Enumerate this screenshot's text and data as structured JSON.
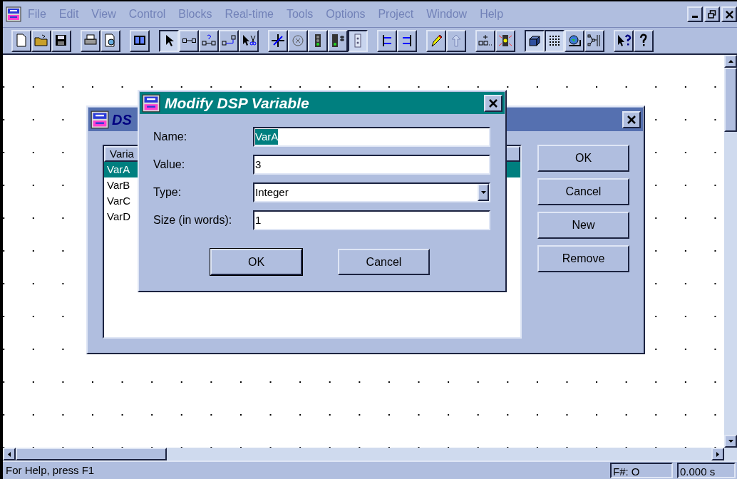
{
  "menu": [
    "File",
    "Edit",
    "View",
    "Control",
    "Blocks",
    "Real-time",
    "Tools",
    "Options",
    "Project",
    "Window",
    "Help"
  ],
  "toolbar": [
    [
      {
        "pressed": false
      },
      {
        "pressed": false
      },
      {
        "pressed": false
      }
    ],
    [
      {
        "pressed": false
      },
      {
        "pressed": false
      }
    ],
    [
      {
        "pressed": false
      }
    ],
    [
      {
        "pressed": true
      },
      {
        "pressed": false
      },
      {
        "pressed": false
      },
      {
        "pressed": false
      },
      {
        "pressed": false
      }
    ],
    [
      {
        "pressed": false
      },
      {
        "pressed": false
      },
      {
        "pressed": false
      },
      {
        "pressed": false
      },
      {
        "pressed": true
      }
    ],
    [
      {
        "pressed": false
      },
      {
        "pressed": false
      }
    ],
    [
      {
        "pressed": false
      },
      {
        "pressed": false
      }
    ],
    [
      {
        "pressed": false
      },
      {
        "pressed": false
      }
    ],
    [
      {
        "pressed": true
      },
      {
        "pressed": true
      },
      {
        "pressed": false
      },
      {
        "pressed": false
      }
    ],
    [
      {
        "pressed": false
      },
      {
        "pressed": false
      }
    ]
  ],
  "variables_dialog": {
    "title": "DS",
    "list_header": "Varia",
    "rows": [
      {
        "name": "VarA",
        "selected": true
      },
      {
        "name": "VarB",
        "selected": false
      },
      {
        "name": "VarC",
        "selected": false
      },
      {
        "name": "VarD",
        "selected": false
      }
    ],
    "buttons": [
      "OK",
      "Cancel",
      "New",
      "Remove"
    ]
  },
  "modify_dialog": {
    "title": "Modify DSP Variable",
    "fields": [
      {
        "kind": "text",
        "label": "Name:",
        "value": "VarA",
        "highlighted": true
      },
      {
        "kind": "text",
        "label": "Value:",
        "value": "3",
        "highlighted": false
      },
      {
        "kind": "select",
        "label": "Type:",
        "value": "Integer",
        "highlighted": false
      },
      {
        "kind": "text",
        "label": "Size (in words):",
        "value": "1",
        "highlighted": false
      }
    ],
    "buttons": [
      {
        "label": "OK",
        "default": true
      },
      {
        "label": "Cancel",
        "default": false
      }
    ]
  },
  "status_bar": {
    "message": "For Help, press F1",
    "frame": "F#: O",
    "time": "0.000 s"
  }
}
